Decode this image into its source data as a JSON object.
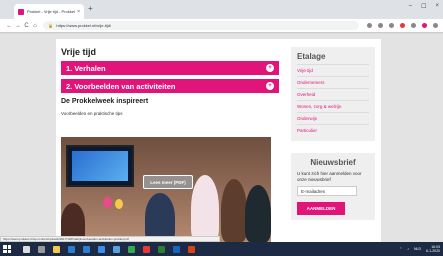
{
  "browser": {
    "tab_title": "Prokkel - Vrije tijd - Prokkel",
    "tab_close": "×",
    "new_tab": "+",
    "window_controls": [
      "–",
      "☐",
      "×"
    ],
    "url": "https://www.prokkel.nl/vrije-tijd/",
    "nav": [
      "←",
      "→",
      "C",
      "⌂"
    ]
  },
  "page": {
    "title": "Vrije tijd",
    "accordions": [
      {
        "label": "1. Verhalen",
        "icon": "+"
      },
      {
        "label": "2. Voorbeelden van activiteiten",
        "icon": "+"
      }
    ],
    "section_heading": "De Prokkelweek inspireert",
    "section_text": "Voorbeelden en praktische tips",
    "pdf_button": "Lees meer (PDF)"
  },
  "sidebar": {
    "etalage_title": "Etalage",
    "etalage_links": [
      "Vrije tijd",
      "Ondernemers",
      "Overheid",
      "Wonen, zorg & welzijn",
      "Onderwijs",
      "Particulier"
    ],
    "newsletter_title": "Nieuwsbrief",
    "newsletter_text": "U kunt zich hier aanmelden voor onze nieuwsbrief",
    "email_placeholder": "E-mailadres",
    "subscribe_label": "AANMELDEN"
  },
  "statusbar": {
    "text": "https://www.prokkel.nl/wp-content/uploads/2017/10/Praktijkvoorbeelden-activiteiten-prokkel.pdf"
  },
  "taskbar": {
    "time": "16:03",
    "date": "6-1-2020",
    "tray_label": "NLD"
  },
  "colors": {
    "accent": "#e1147a",
    "taskbar": "#1c2a44"
  }
}
